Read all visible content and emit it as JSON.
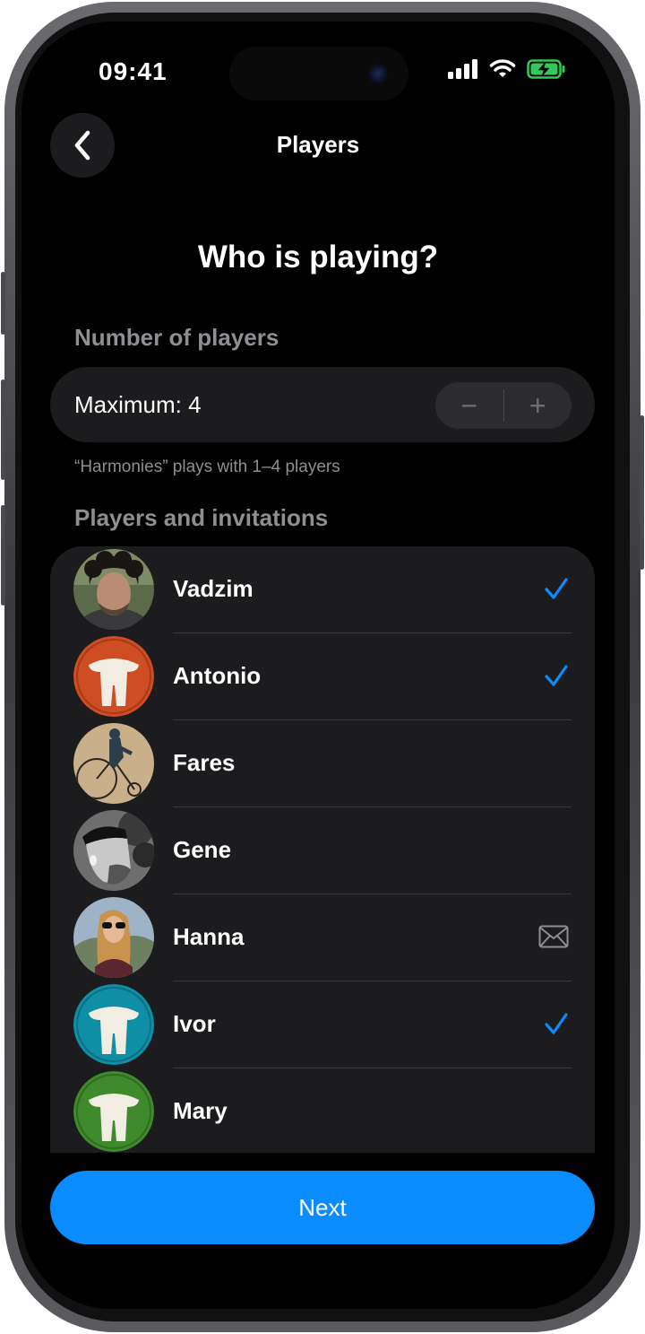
{
  "status_bar": {
    "time": "09:41",
    "icons": [
      "cellular-signal-icon",
      "wifi-icon",
      "battery-charging-icon"
    ]
  },
  "nav": {
    "back_icon": "chevron-left-icon",
    "title": "Players"
  },
  "heading": "Who is playing?",
  "number_section": {
    "label": "Number of players",
    "maximum_label": "Maximum: 4",
    "stepper": {
      "minus": "−",
      "plus": "+"
    },
    "note": "“Harmonies” plays with 1–4 players"
  },
  "players_section": {
    "label": "Players and invitations",
    "players": [
      {
        "name": "Vadzim",
        "avatar": "photo-avatar",
        "status": "checked"
      },
      {
        "name": "Antonio",
        "avatar": "mushroom-avatar",
        "avatar_color": "#cf4d23",
        "status": "checked"
      },
      {
        "name": "Fares",
        "avatar": "photo-avatar",
        "status": "none"
      },
      {
        "name": "Gene",
        "avatar": "photo-avatar",
        "status": "none"
      },
      {
        "name": "Hanna",
        "avatar": "photo-avatar",
        "status": "invited"
      },
      {
        "name": "Ivor",
        "avatar": "mushroom-avatar",
        "avatar_color": "#0f8fa6",
        "status": "checked"
      },
      {
        "name": "Mary",
        "avatar": "mushroom-avatar",
        "avatar_color": "#3f8a2c",
        "status": "none"
      }
    ]
  },
  "next_button": "Next",
  "colors": {
    "accent": "#0a8cff",
    "background": "#000000",
    "card": "#1c1c1e",
    "secondary_text": "#8e8e93"
  }
}
